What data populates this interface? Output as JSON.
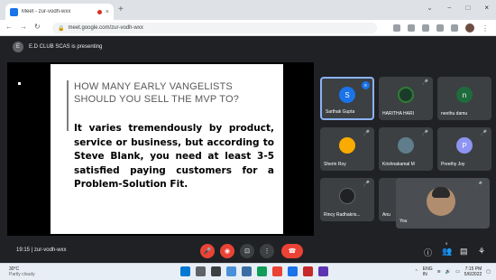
{
  "browser": {
    "tab_title": "Meet - zur-vodh-wxx",
    "tab_close": "×",
    "new_tab": "+",
    "url": "meet.google.com/zur-vodh-wxx",
    "window_controls": [
      "⌄",
      "−",
      "□",
      "×"
    ]
  },
  "presenting": {
    "text": "E.D CLUB SCAS is presenting",
    "avatar_letter": "E"
  },
  "slide": {
    "heading": "HOW MANY EARLY VANGELISTS SHOULD YOU SELL THE MVP TO?",
    "body": "It varies tremendously by product, service or business, but according to Steve Blank, you need at least 3-5 satisfied paying customers for a Problem-Solution Fit."
  },
  "participants": [
    {
      "name": "Sarthak Gupta",
      "initial": "S",
      "color": "#1a73e8",
      "speaking": true
    },
    {
      "name": "HARITHA HARI",
      "initial": "",
      "color": "#2e7d32",
      "speaking": false
    },
    {
      "name": "neethu damu",
      "initial": "n",
      "color": "#1e6b3c",
      "speaking": false
    },
    {
      "name": "Sherin Roy",
      "initial": "",
      "color": "#f9ab00",
      "speaking": false
    },
    {
      "name": "Krishnakamal M",
      "initial": "",
      "color": "#607d8b",
      "speaking": false
    },
    {
      "name": "Preethy Joy",
      "initial": "P",
      "color": "#8e94f2",
      "speaking": false
    },
    {
      "name": "Rincy Radhakris...",
      "initial": "",
      "color": "#202124",
      "speaking": false
    },
    {
      "name": "Anu",
      "initial": "",
      "color": "#3c4043",
      "speaking": false
    }
  ],
  "self": {
    "name": "You"
  },
  "controls": {
    "time": "19:15",
    "meeting_code": "zur-vodh-wxx",
    "people_count": "9"
  },
  "taskbar": {
    "weather_temp": "30°C",
    "weather_desc": "Partly cloudy",
    "lang": "ENG",
    "region": "IN",
    "time": "7:15 PM",
    "date": "5/6/2022"
  }
}
